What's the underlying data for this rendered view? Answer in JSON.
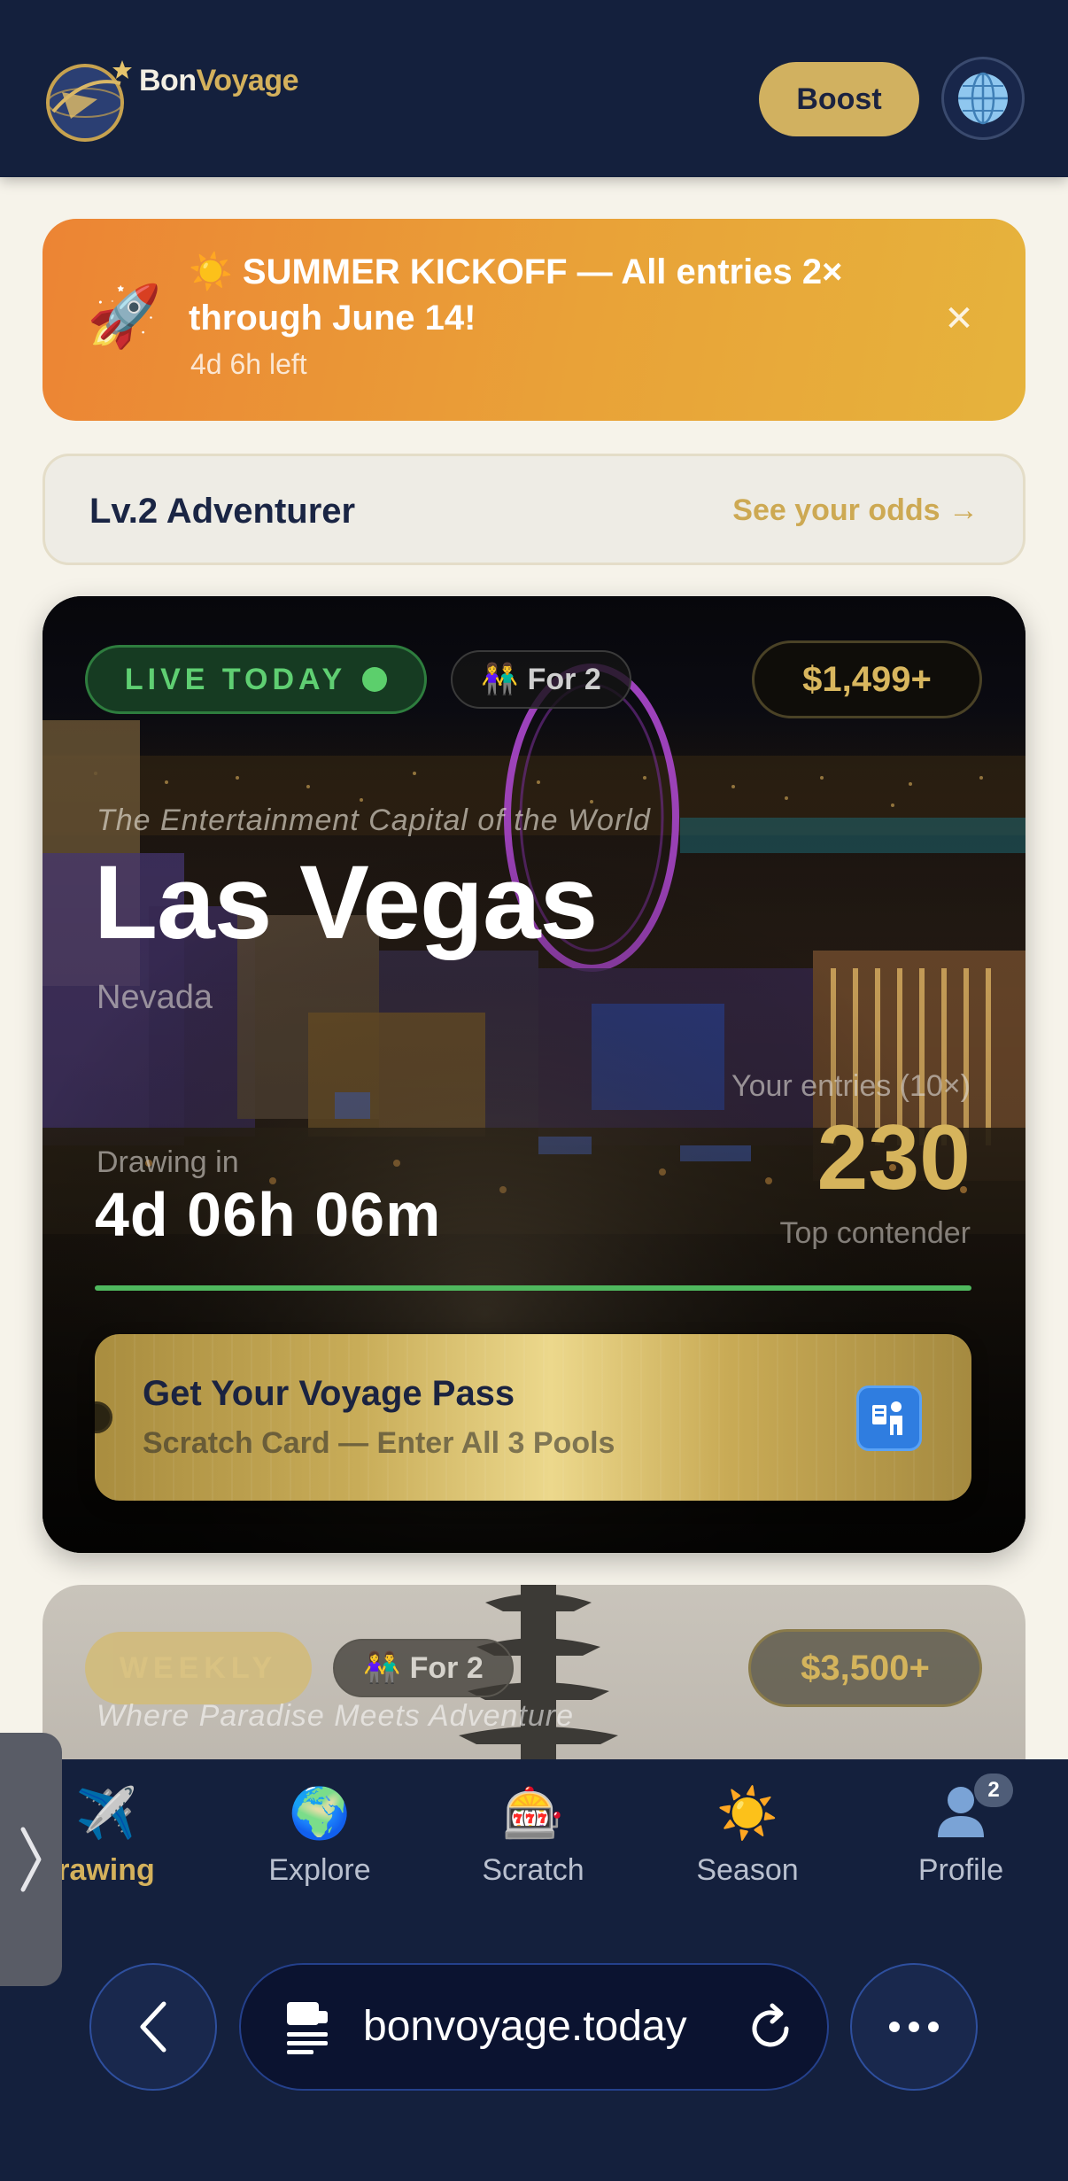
{
  "header": {
    "brand_part1": "Bon",
    "brand_part2": "Voyage",
    "boost_label": "Boost",
    "globe_icon": "globe-icon"
  },
  "promo": {
    "icon": "🚀",
    "title": "☀️ SUMMER KICKOFF — All entries 2× through June 14!",
    "time_left": "4d 6h left",
    "close_label": "✕"
  },
  "level": {
    "label": "Lv.2 Adventurer",
    "odds_link": "See your odds →"
  },
  "featured": {
    "status_pill": "LIVE TODAY",
    "party_icon": "👫",
    "party_label": "For 2",
    "price": "$1,499+",
    "tagline": "The Entertainment Capital of the World",
    "city": "Las Vegas",
    "state": "Nevada",
    "drawing_label": "Drawing in",
    "countdown": "4d 06h 06m",
    "entries_label": "Your entries (10×)",
    "entries_count": "230",
    "entries_rank": "Top contender",
    "progress": 1.0,
    "pass_title": "Get Your Voyage Pass",
    "pass_subtitle": "Scratch Card — Enter All 3 Pools",
    "pass_icon": "passport-control-icon"
  },
  "next_card": {
    "status_pill": "WEEKLY",
    "party_icon": "👫",
    "party_label": "For 2",
    "price": "$3,500+",
    "tagline": "Where Paradise Meets Adventure"
  },
  "tabs": [
    {
      "icon": "✈️",
      "label": "rawing"
    },
    {
      "icon": "🌍",
      "label": "Explore"
    },
    {
      "icon": "🎰",
      "label": "Scratch"
    },
    {
      "icon": "☀️",
      "label": "Season"
    },
    {
      "icon": "👤",
      "label": "Profile"
    }
  ],
  "profile_badge": "2",
  "browser": {
    "url": "bonvoyage.today"
  },
  "colors": {
    "navy": "#14203d",
    "gold": "#d4b15c",
    "live_green": "#5fcf72",
    "promo_orange": "#ec8434"
  }
}
